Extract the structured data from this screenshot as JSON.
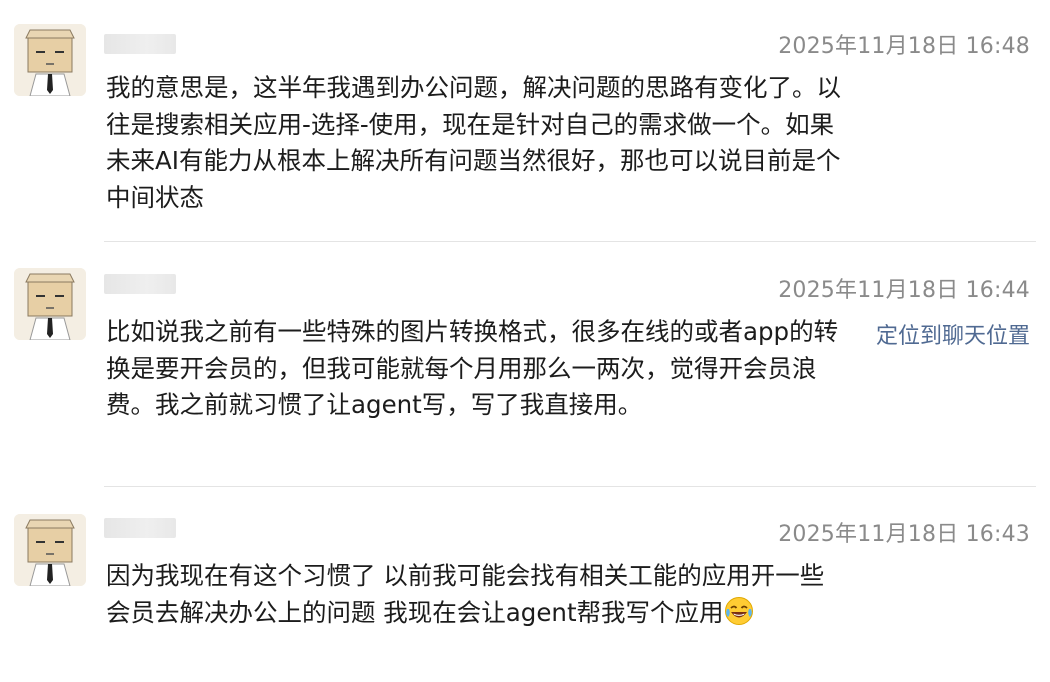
{
  "messages": [
    {
      "time": "2025年11月18日 16:48",
      "text": "我的意思是，这半年我遇到办公问题，解决问题的思路有变化了。以往是搜索相关应用-选择-使用，现在是针对自己的需求做一个。如果未来AI有能力从根本上解决所有问题当然很好，那也可以说目前是个中间状态"
    },
    {
      "time": "2025年11月18日 16:44",
      "text": "比如说我之前有一些特殊的图片转换格式，很多在线的或者app的转换是要开会员的，但我可能就每个月用那么一两次，觉得开会员浪费。我之前就习惯了让agent写，写了我直接用。",
      "locate_label": "定位到聊天位置"
    },
    {
      "time": "2025年11月18日 16:43",
      "text": "因为我现在有这个习惯了 以前我可能会找有相关工能的应用开一些会员去解决办公上的问题 我现在会让agent帮我写个应用",
      "emoji": "laughing-with-tears-emoji"
    }
  ]
}
